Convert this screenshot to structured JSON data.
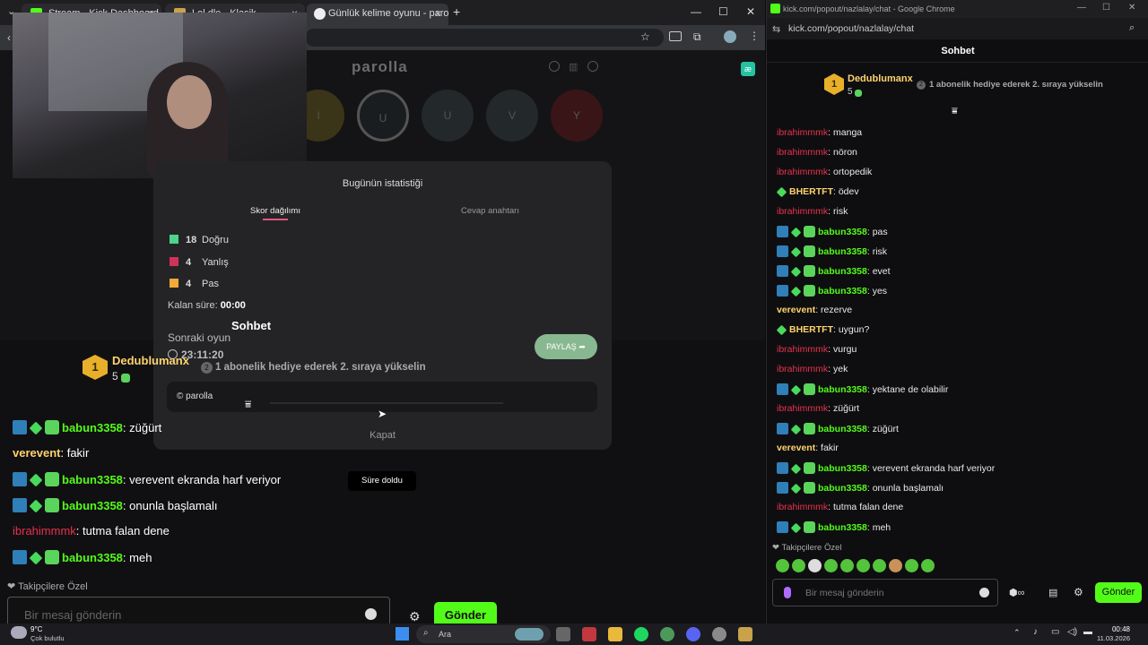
{
  "left_browser": {
    "tabs": [
      {
        "label": "Stream - Kick Dashboard",
        "close": "×"
      },
      {
        "label": "Lol dle - Klasik",
        "close": "×"
      },
      {
        "label": "Günlük kelime oyunu - parolla",
        "close": "×"
      }
    ],
    "new_tab": "+",
    "window_controls": {
      "minimize": "—",
      "maximize": "☐",
      "close": "✕"
    }
  },
  "game": {
    "title": "parolla",
    "letters": [
      "I",
      "U",
      "U",
      "V",
      "Y"
    ],
    "modal": {
      "title": "Bugünün istatistiği",
      "tabs": [
        "Skor dağılımı",
        "Cevap anahtarı"
      ],
      "stats": [
        {
          "count": "18",
          "label": "Doğru",
          "color": "#4fd38a"
        },
        {
          "count": "4",
          "label": "Yanlış",
          "color": "#d0335a"
        },
        {
          "count": "4",
          "label": "Pas",
          "color": "#f2a93b"
        }
      ],
      "remaining_label": "Kalan süre:",
      "remaining_value": "00:00",
      "next_game_label": "Sonraki oyun",
      "next_game_time": "23:11:20",
      "share_button": "PAYLAŞ",
      "footer_brand": "© parolla",
      "close_button": "Kapat"
    },
    "toast": "Süre doldu"
  },
  "overlay_chat": {
    "header": "Sohbet",
    "top_gifter": {
      "rank": "1",
      "name": "Dedublumanx",
      "count": "5"
    },
    "gift_cta": {
      "rank": "2",
      "text": "1 abonelik hediye ederek 2. sıraya yükselin"
    },
    "messages": [
      {
        "user": "babun3358",
        "text": "züğürt",
        "color": "green",
        "badges": [
          "mod",
          "vip",
          "gift"
        ]
      },
      {
        "user": "verevent",
        "text": "fakir",
        "color": "yellow",
        "badges": []
      },
      {
        "user": "babun3358",
        "text": "verevent ekranda harf veriyor",
        "color": "green",
        "badges": [
          "mod",
          "vip",
          "gift"
        ]
      },
      {
        "user": "babun3358",
        "text": "onunla başlamalı",
        "color": "green",
        "badges": [
          "mod",
          "vip",
          "gift"
        ]
      },
      {
        "user": "ibrahimmmk",
        "text": "tutma falan dene",
        "color": "red",
        "badges": []
      },
      {
        "user": "babun3358",
        "text": "meh",
        "color": "green",
        "badges": [
          "mod",
          "vip",
          "gift"
        ]
      }
    ],
    "followers_only": "Takipçilere Özel",
    "input_placeholder": "Bir mesaj gönderin",
    "send_button": "Gönder"
  },
  "right_window": {
    "title": "kick.com/popout/nazlalay/chat - Google Chrome",
    "url": "kick.com/popout/nazlalay/chat",
    "header": "Sohbet",
    "top_gifter": {
      "rank": "1",
      "name": "Dedublumanx",
      "count": "5"
    },
    "gift_cta": {
      "rank": "2",
      "text": "1 abonelik hediye ederek 2. sıraya yükselin"
    },
    "messages": [
      {
        "user": "ibrahimmmk",
        "text": "manga",
        "color": "red",
        "badges": []
      },
      {
        "user": "ibrahimmmk",
        "text": "nöron",
        "color": "red",
        "badges": []
      },
      {
        "user": "ibrahimmmk",
        "text": "ortopedik",
        "color": "red",
        "badges": []
      },
      {
        "user": "BHERTFT",
        "text": "ödev",
        "color": "yellow",
        "badges": [
          "vip"
        ]
      },
      {
        "user": "ibrahimmmk",
        "text": "risk",
        "color": "red",
        "badges": []
      },
      {
        "user": "babun3358",
        "text": "pas",
        "color": "green",
        "badges": [
          "mod",
          "vip",
          "gift"
        ]
      },
      {
        "user": "babun3358",
        "text": "risk",
        "color": "green",
        "badges": [
          "mod",
          "vip",
          "gift"
        ]
      },
      {
        "user": "babun3358",
        "text": "evet",
        "color": "green",
        "badges": [
          "mod",
          "vip",
          "gift"
        ]
      },
      {
        "user": "babun3358",
        "text": "yes",
        "color": "green",
        "badges": [
          "mod",
          "vip",
          "gift"
        ]
      },
      {
        "user": "verevent",
        "text": "rezerve",
        "color": "yellow",
        "badges": []
      },
      {
        "user": "BHERTFT",
        "text": "uygun?",
        "color": "yellow",
        "badges": [
          "vip"
        ]
      },
      {
        "user": "ibrahimmmk",
        "text": "vurgu",
        "color": "red",
        "badges": []
      },
      {
        "user": "ibrahimmmk",
        "text": "yek",
        "color": "red",
        "badges": []
      },
      {
        "user": "babun3358",
        "text": "yektane de olabilir",
        "color": "green",
        "badges": [
          "mod",
          "vip",
          "gift"
        ]
      },
      {
        "user": "ibrahimmmk",
        "text": "züğürt",
        "color": "red",
        "badges": []
      },
      {
        "user": "babun3358",
        "text": "züğürt",
        "color": "green",
        "badges": [
          "mod",
          "vip",
          "gift"
        ]
      },
      {
        "user": "verevent",
        "text": "fakir",
        "color": "yellow",
        "badges": []
      },
      {
        "user": "babun3358",
        "text": "verevent ekranda harf veriyor",
        "color": "green",
        "badges": [
          "mod",
          "vip",
          "gift"
        ]
      },
      {
        "user": "babun3358",
        "text": "onunla başlamalı",
        "color": "green",
        "badges": [
          "mod",
          "vip",
          "gift"
        ]
      },
      {
        "user": "ibrahimmmk",
        "text": "tutma falan dene",
        "color": "red",
        "badges": []
      },
      {
        "user": "babun3358",
        "text": "meh",
        "color": "green",
        "badges": [
          "mod",
          "vip",
          "gift"
        ]
      }
    ],
    "followers_only": "Takipçilere Özel",
    "input_placeholder": "Bir mesaj gönderin",
    "send_button": "Gönder"
  },
  "taskbar": {
    "weather_temp": "9°C",
    "weather_desc": "Çok bulutlu",
    "search_label": "Ara",
    "time": "00:48",
    "date": "11.03.2026"
  },
  "colors": {
    "kick_green": "#53fc18",
    "name_red": "#e8324e",
    "name_yellow": "#ffd36e"
  }
}
